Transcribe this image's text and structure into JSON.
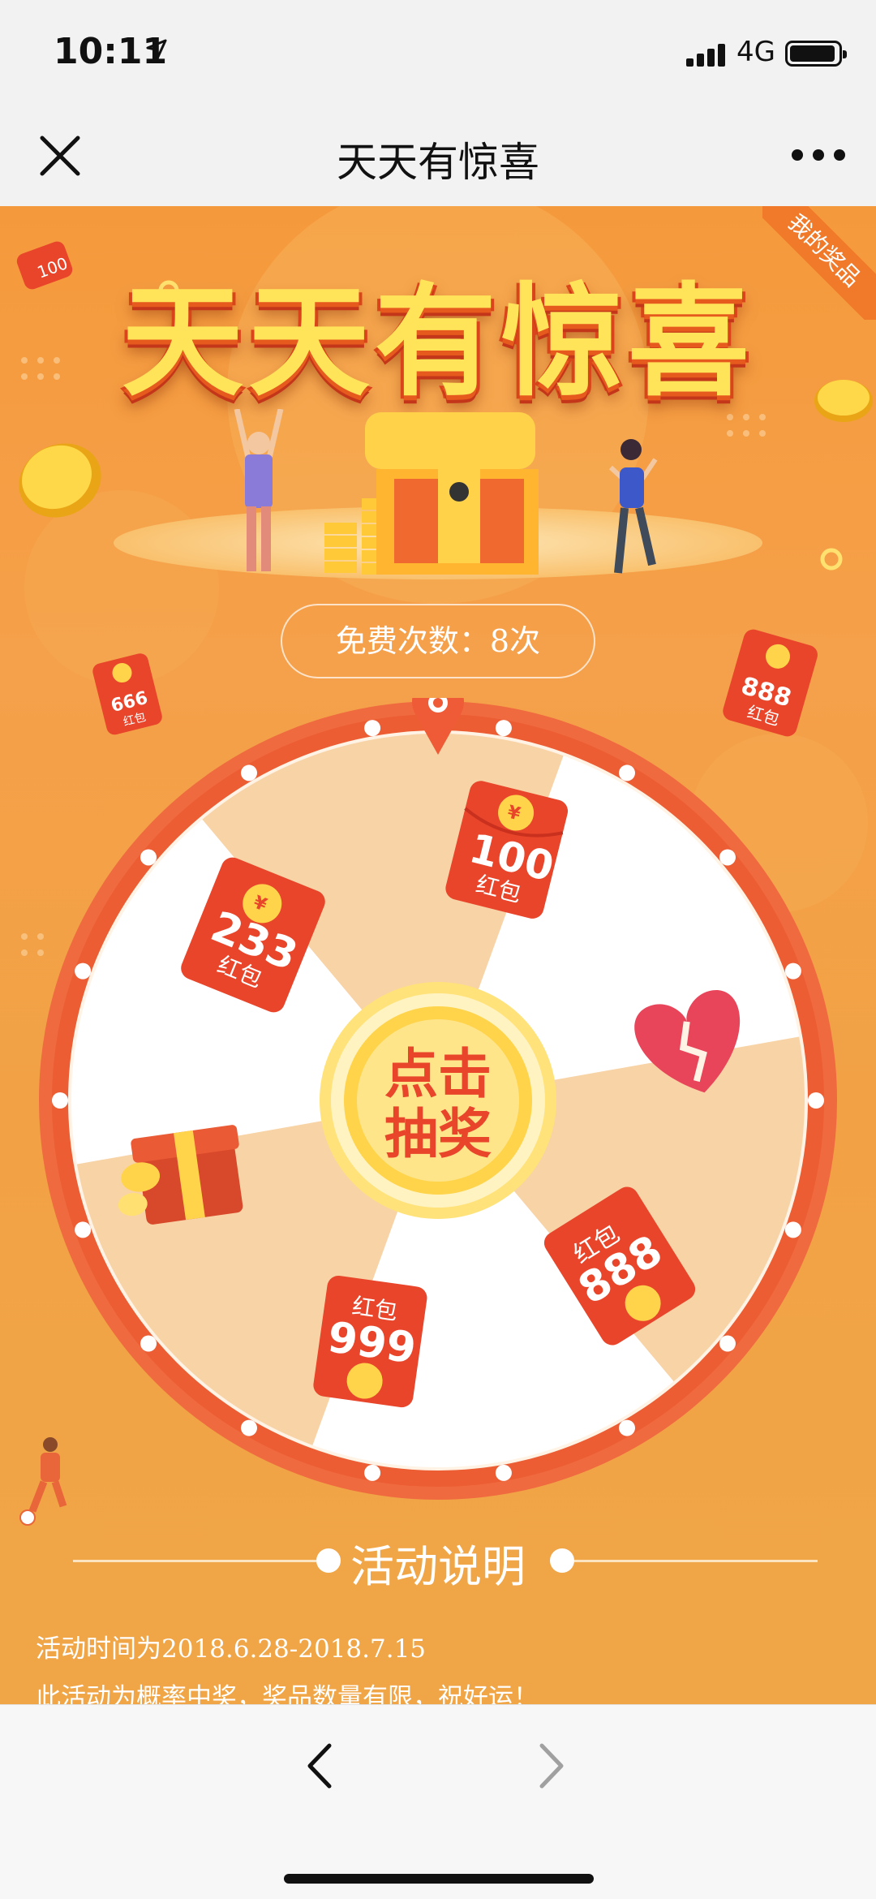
{
  "status": {
    "time": "10:11",
    "network": "4G"
  },
  "nav": {
    "title": "天天有惊喜"
  },
  "banner": {
    "title": "天天有惊喜",
    "my_prizes": "我的奖品",
    "badge_100": "100"
  },
  "free_count": {
    "label": "免费次数：8次"
  },
  "side_packets": {
    "left": {
      "amount": "666",
      "text": "红包"
    },
    "right": {
      "amount": "888",
      "text": "红包"
    }
  },
  "wheel": {
    "center_label": "点击抽奖",
    "center_line1": "点击",
    "center_line2": "抽奖",
    "prizes": [
      {
        "name": "100红包",
        "amount": "100",
        "text": "红包"
      },
      {
        "name": "谢谢参与",
        "icon": "broken-heart-icon"
      },
      {
        "name": "888红包",
        "amount": "888",
        "text": "红包"
      },
      {
        "name": "999红包",
        "amount": "999",
        "text": "红包"
      },
      {
        "name": "礼物",
        "icon": "gift-box-icon"
      },
      {
        "name": "233红包",
        "amount": "233",
        "text": "红包"
      }
    ],
    "colors": {
      "rim": "#ef6a3f",
      "slice_light": "#f8d3a6",
      "slice_white": "#ffffff",
      "packet": "#e84a2c",
      "coin": "#ffd34a"
    }
  },
  "description": {
    "title": "活动说明",
    "rules": [
      "活动时间为2018.6.28-2018.7.15",
      "此活动为概率中奖，奖品数量有限，祝好运！"
    ]
  }
}
